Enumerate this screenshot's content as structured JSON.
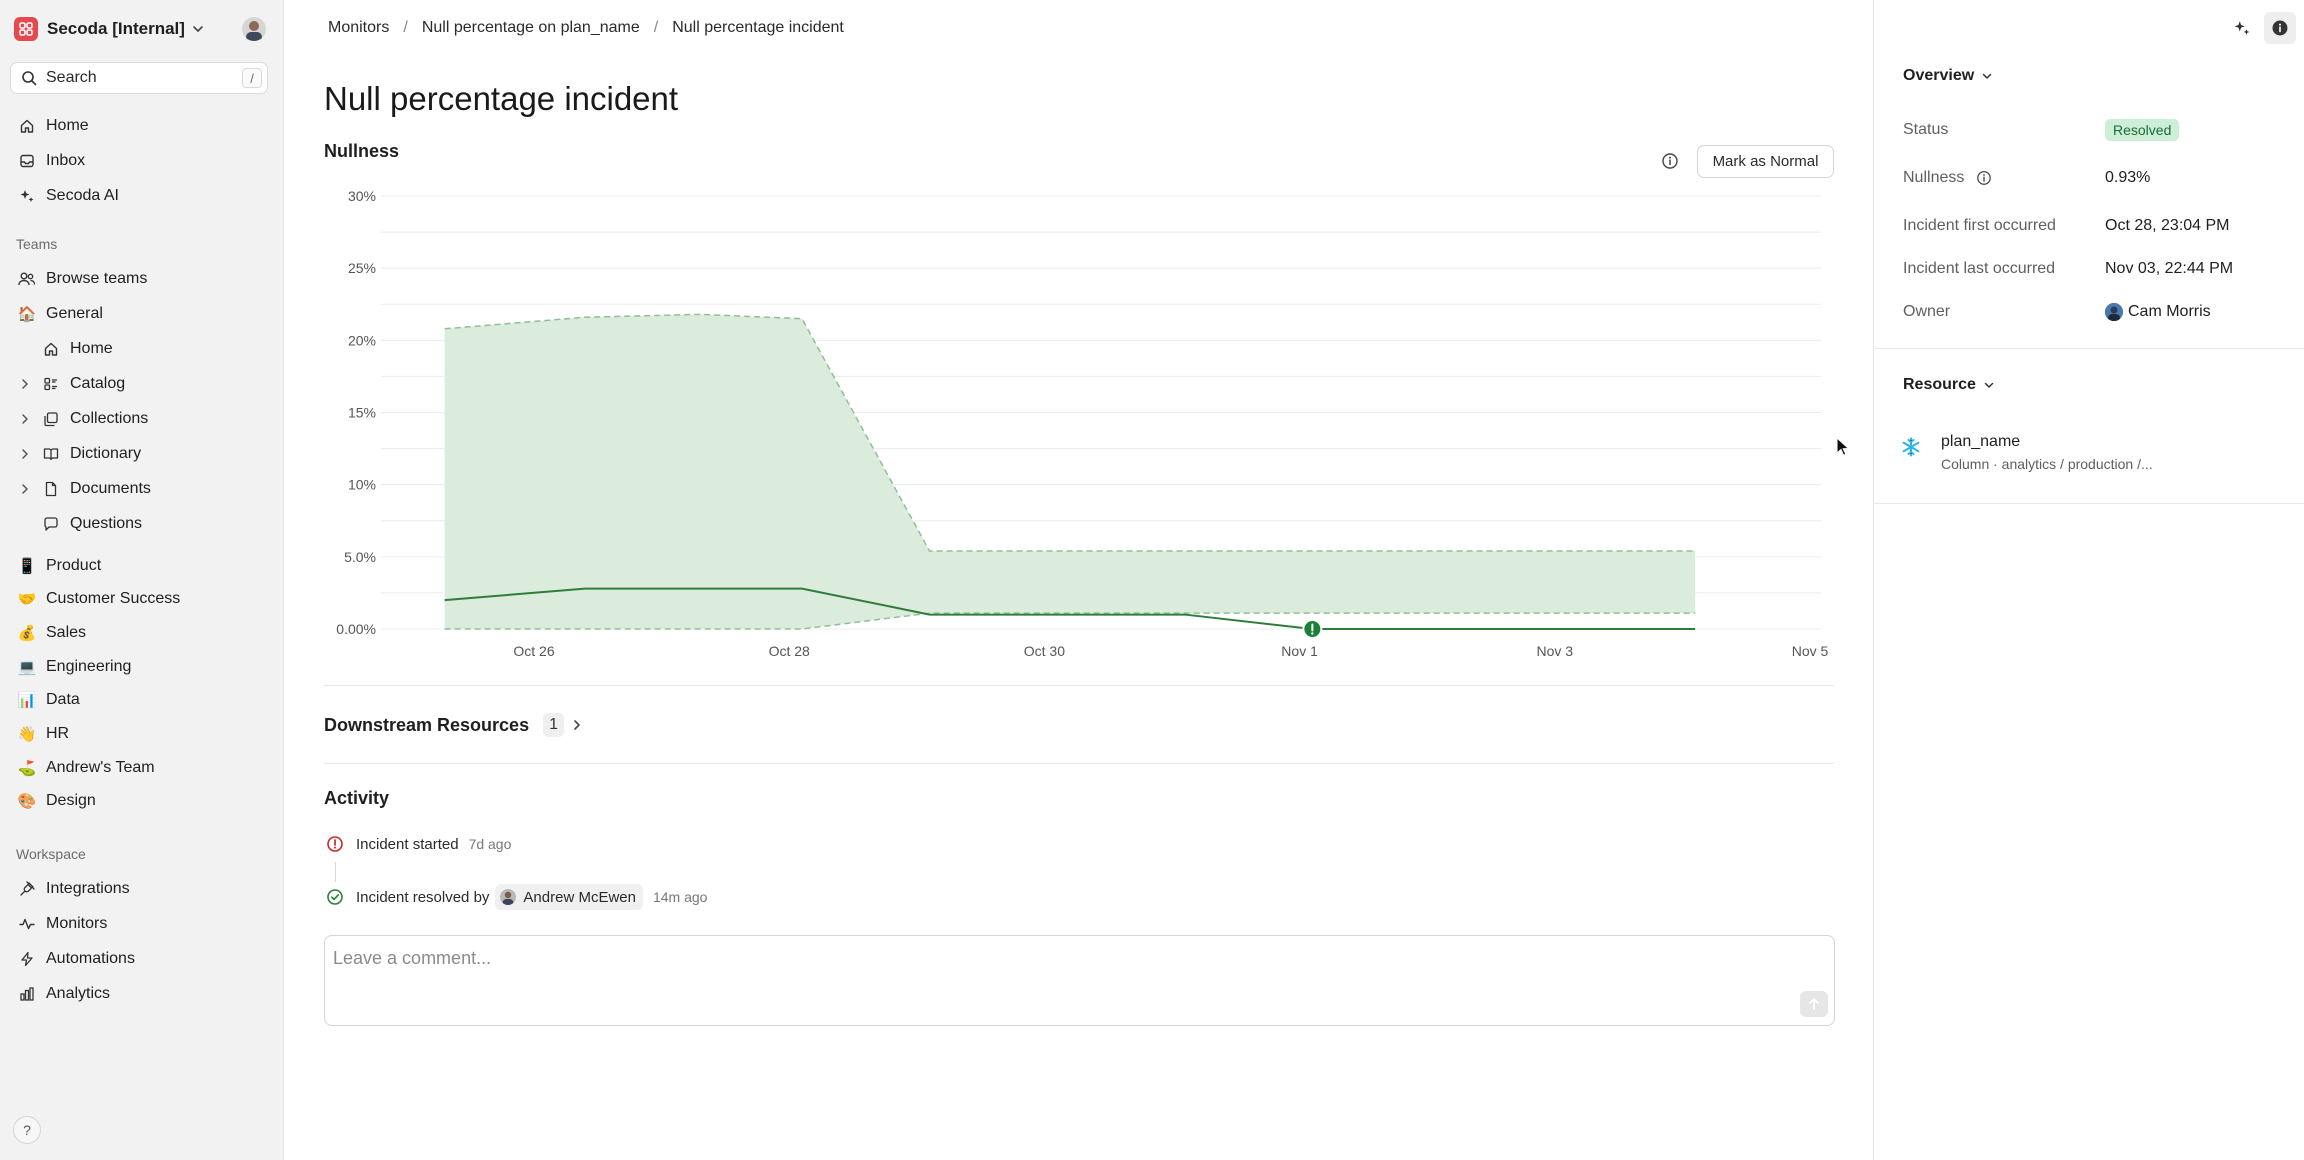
{
  "workspace": {
    "name": "Secoda [Internal]"
  },
  "search": {
    "label": "Search",
    "shortcut": "/"
  },
  "nav": {
    "top": [
      {
        "label": "Home",
        "icon": "home-icon"
      },
      {
        "label": "Inbox",
        "icon": "inbox-icon"
      },
      {
        "label": "Secoda AI",
        "icon": "sparkle-icon"
      }
    ],
    "teams_label": "Teams",
    "browse_teams": "Browse teams",
    "general": "General",
    "general_children": [
      {
        "label": "Home",
        "expandable": false
      },
      {
        "label": "Catalog",
        "expandable": true
      },
      {
        "label": "Collections",
        "expandable": true
      },
      {
        "label": "Dictionary",
        "expandable": true
      },
      {
        "label": "Documents",
        "expandable": true
      },
      {
        "label": "Questions",
        "expandable": false
      }
    ],
    "teams": [
      {
        "label": "Product",
        "emoji": "📱"
      },
      {
        "label": "Customer Success",
        "emoji": "🤝"
      },
      {
        "label": "Sales",
        "emoji": "💰"
      },
      {
        "label": "Engineering",
        "emoji": "💻"
      },
      {
        "label": "Data",
        "emoji": "📊"
      },
      {
        "label": "HR",
        "emoji": "👋"
      },
      {
        "label": "Andrew's Team",
        "emoji": "⛳"
      },
      {
        "label": "Design",
        "emoji": "🎨"
      }
    ],
    "workspace_label": "Workspace",
    "workspace_items": [
      {
        "label": "Integrations",
        "icon": "plug-icon"
      },
      {
        "label": "Monitors",
        "icon": "activity-icon"
      },
      {
        "label": "Automations",
        "icon": "bolt-icon"
      },
      {
        "label": "Analytics",
        "icon": "bar-chart-icon"
      }
    ],
    "help": "?"
  },
  "breadcrumb": [
    "Monitors",
    "Null percentage on plan_name",
    "Null percentage incident"
  ],
  "page": {
    "title": "Null percentage incident",
    "chart_section_title": "Nullness",
    "mark_normal": "Mark as Normal",
    "downstream_title": "Downstream Resources",
    "downstream_count": "1",
    "activity_title": "Activity",
    "activity": [
      {
        "text": "Incident started",
        "ago": "7d ago",
        "status": "error"
      },
      {
        "text": "Incident resolved by",
        "user": "Andrew McEwen",
        "ago": "14m ago",
        "status": "success"
      }
    ],
    "comment_placeholder": "Leave a comment..."
  },
  "chart_data": {
    "type": "area",
    "title": "Nullness",
    "xlabel": "",
    "ylabel": "",
    "ylim": [
      0,
      30
    ],
    "y_ticks": [
      "0.00%",
      "5.0%",
      "10%",
      "15%",
      "20%",
      "25%",
      "30%"
    ],
    "x_ticks": [
      "Oct 26",
      "Oct 28",
      "Oct 30",
      "Nov 1",
      "Nov 3",
      "Nov 5"
    ],
    "x_domain": [
      "Oct 25.3",
      "Nov 5"
    ],
    "series": [
      {
        "name": "",
        "kind": "line",
        "color": "#2e7d3b",
        "points": [
          [
            "Oct 25.3",
            2.0
          ],
          [
            "Oct 26.4",
            2.8
          ],
          [
            "Oct 28.1",
            2.8
          ],
          [
            "Oct 29.1",
            1.0
          ],
          [
            "Oct 31.1",
            1.0
          ],
          [
            "Nov 1.1",
            0.0
          ],
          [
            "Nov 4.1",
            0.0
          ]
        ]
      }
    ],
    "band": {
      "color": "#dbebdc",
      "border": "#8fbf95",
      "upper": [
        [
          "Oct 25.3",
          20.8
        ],
        [
          "Oct 26.4",
          21.6
        ],
        [
          "Oct 27.3",
          21.8
        ],
        [
          "Oct 28.1",
          21.5
        ],
        [
          "Oct 29.1",
          5.4
        ],
        [
          "Nov 4.1",
          5.4
        ]
      ],
      "lower": [
        [
          "Oct 25.3",
          0.0
        ],
        [
          "Oct 28.1",
          0.0
        ],
        [
          "Oct 29.1",
          1.1
        ],
        [
          "Nov 4.1",
          1.1
        ]
      ]
    },
    "incident_marker": {
      "x": "Nov 1.1",
      "y": 0.0,
      "color": "#1a7f37"
    },
    "grid": true,
    "legend": "none"
  },
  "overview": {
    "title": "Overview",
    "status_label": "Status",
    "status_value": "Resolved",
    "nullness_label": "Nullness",
    "nullness_value": "0.93%",
    "first_label": "Incident first occurred",
    "first_value": "Oct 28, 23:04 PM",
    "last_label": "Incident last occurred",
    "last_value": "Nov 03, 22:44 PM",
    "owner_label": "Owner",
    "owner_value": "Cam Morris"
  },
  "resource": {
    "title": "Resource",
    "name": "plan_name",
    "path": "Column · analytics / production /..."
  },
  "colors": {
    "accent_green": "#1a7f37",
    "error_red": "#c62828",
    "logo_red": "#e5484d"
  }
}
